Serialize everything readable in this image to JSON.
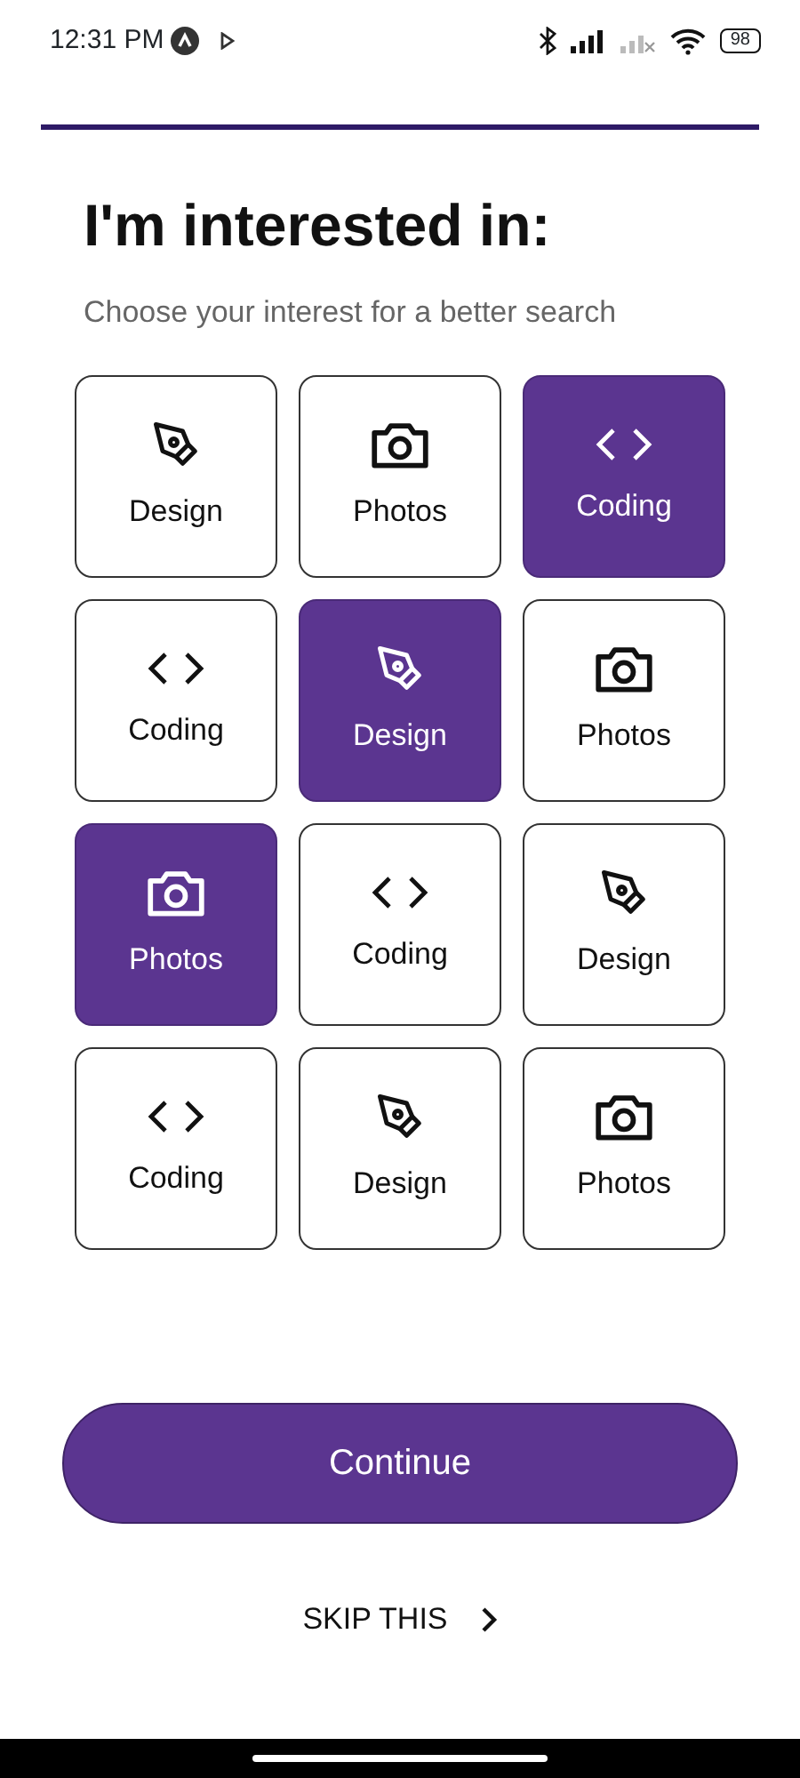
{
  "status_bar": {
    "time": "12:31 PM",
    "battery": "98"
  },
  "progress": {
    "level": 1
  },
  "title": "I'm interested in:",
  "subtitle": "Choose your interest for a better search",
  "interests": [
    {
      "kind": "design",
      "label": "Design",
      "selected": false
    },
    {
      "kind": "photos",
      "label": "Photos",
      "selected": false
    },
    {
      "kind": "coding",
      "label": "Coding",
      "selected": true
    },
    {
      "kind": "coding",
      "label": "Coding",
      "selected": false
    },
    {
      "kind": "design",
      "label": "Design",
      "selected": true
    },
    {
      "kind": "photos",
      "label": "Photos",
      "selected": false
    },
    {
      "kind": "photos",
      "label": "Photos",
      "selected": true
    },
    {
      "kind": "coding",
      "label": "Coding",
      "selected": false
    },
    {
      "kind": "design",
      "label": "Design",
      "selected": false
    },
    {
      "kind": "coding",
      "label": "Coding",
      "selected": false
    },
    {
      "kind": "design",
      "label": "Design",
      "selected": false
    },
    {
      "kind": "photos",
      "label": "Photos",
      "selected": false
    }
  ],
  "continue_button": "Continue",
  "skip_link": "SKIP THIS"
}
